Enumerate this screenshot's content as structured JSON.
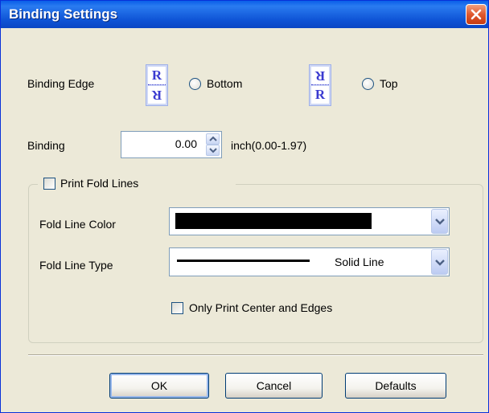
{
  "dialog": {
    "title": "Binding Settings",
    "close_icon": "close-icon"
  },
  "binding_edge": {
    "label": "Binding Edge",
    "options": [
      {
        "label": "Bottom",
        "selected": false,
        "icon": "binding-bottom-icon"
      },
      {
        "label": "Top",
        "selected": false,
        "icon": "binding-top-icon"
      }
    ],
    "icon_glyph": "R"
  },
  "binding": {
    "label": "Binding",
    "value": "0.00",
    "unit_range": "inch(0.00-1.97)"
  },
  "fold_lines": {
    "checkbox_label": "Print Fold Lines",
    "checked": false,
    "color_label": "Fold Line Color",
    "color_value": "#000000",
    "type_label": "Fold Line Type",
    "type_value": "Solid Line",
    "center_edges_label": "Only Print Center and Edges",
    "center_edges_checked": false
  },
  "buttons": {
    "ok": "OK",
    "cancel": "Cancel",
    "defaults": "Defaults"
  },
  "colors": {
    "titlebar": "#0a5fe8",
    "dialog_bg": "#ece9d8",
    "close_button": "#e0582e",
    "button_border": "#003c74"
  }
}
